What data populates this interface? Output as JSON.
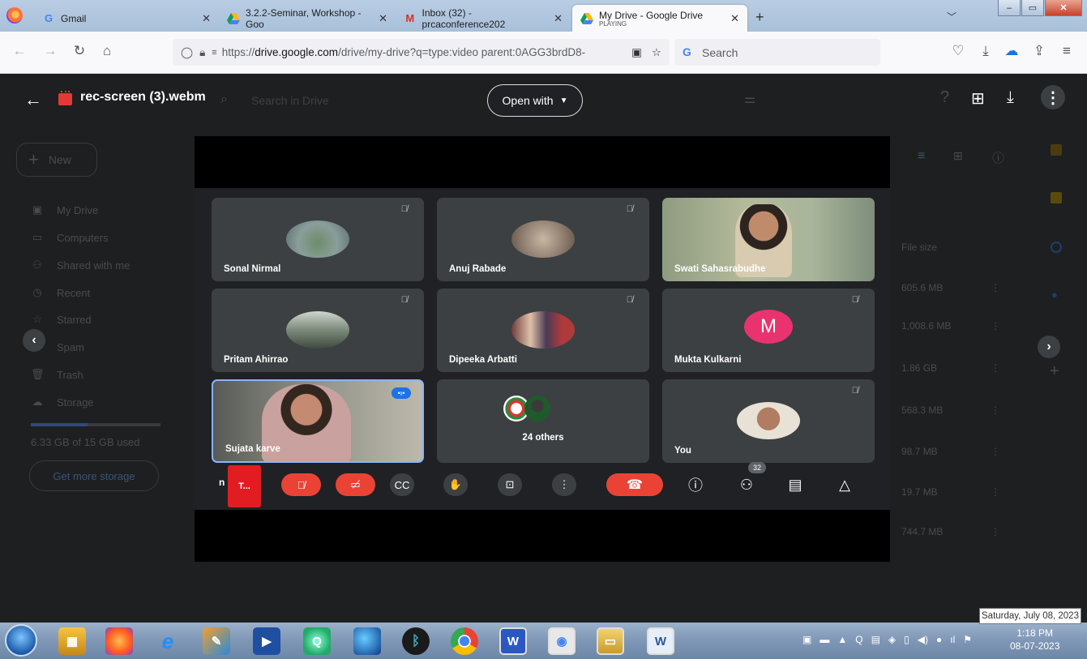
{
  "browser": {
    "tabs": [
      {
        "label": "Gmail",
        "icon": "G"
      },
      {
        "label": "3.2.2-Seminar, Workshop - Goo",
        "icon": "drive"
      },
      {
        "label": "Inbox (32) - prcaconference202",
        "icon": "M"
      },
      {
        "label": "My Drive - Google Drive",
        "sublabel": "PLAYING",
        "icon": "drive"
      }
    ],
    "url_prefix": "https://",
    "url_domain": "drive.google.com",
    "url_rest": "/drive/my-drive?q=type:video parent:0AGG3brdD8-",
    "search_placeholder": "Search"
  },
  "drive": {
    "new_label": "New",
    "sidebar": [
      {
        "label": "My Drive",
        "icon": "drive-icon"
      },
      {
        "label": "Computers",
        "icon": "computer-icon"
      },
      {
        "label": "Shared with me",
        "icon": "people-icon"
      },
      {
        "label": "Recent",
        "icon": "clock-icon"
      },
      {
        "label": "Starred",
        "icon": "star-icon"
      },
      {
        "label": "Spam",
        "icon": "spam-icon"
      },
      {
        "label": "Trash",
        "icon": "trash-icon"
      },
      {
        "label": "Storage",
        "icon": "cloud-icon"
      }
    ],
    "storage_text": "6.33 GB of 15 GB used",
    "get_storage": "Get more storage",
    "search_placeholder": "Search in Drive",
    "file_size_header": "File size",
    "file_sizes": [
      "605.6 MB",
      "1,008.6 MB",
      "1.86 GB",
      "568.3 MB",
      "98.7 MB",
      "19.7 MB",
      "744.7 MB"
    ]
  },
  "viewer": {
    "file_name": "rec-screen (3).webm",
    "open_with": "Open with"
  },
  "meet": {
    "participants": [
      {
        "name": "Sonal Nirmal",
        "type": "avatar",
        "muted": true
      },
      {
        "name": "Anuj Rabade",
        "type": "avatar",
        "muted": true
      },
      {
        "name": "Swati Sahasrabudhe",
        "type": "camera",
        "muted": false
      },
      {
        "name": "Pritam Ahirrao",
        "type": "avatar",
        "muted": true
      },
      {
        "name": "Dipeeka Arbatti",
        "type": "avatar",
        "muted": true
      },
      {
        "name": "Mukta Kulkarni",
        "type": "initial",
        "initial": "M",
        "muted": true
      },
      {
        "name": "Sujata karve",
        "type": "camera",
        "speaking": true
      },
      {
        "name": "24 others",
        "type": "group"
      },
      {
        "name": "You",
        "type": "avatar",
        "muted": true
      }
    ],
    "presenting_label": "T...",
    "meeting_code_prefix": "n",
    "participant_count": "32"
  },
  "taskbar": {
    "time": "1:18 PM",
    "date": "08-07-2023",
    "tooltip": "Saturday, July 08, 2023"
  }
}
